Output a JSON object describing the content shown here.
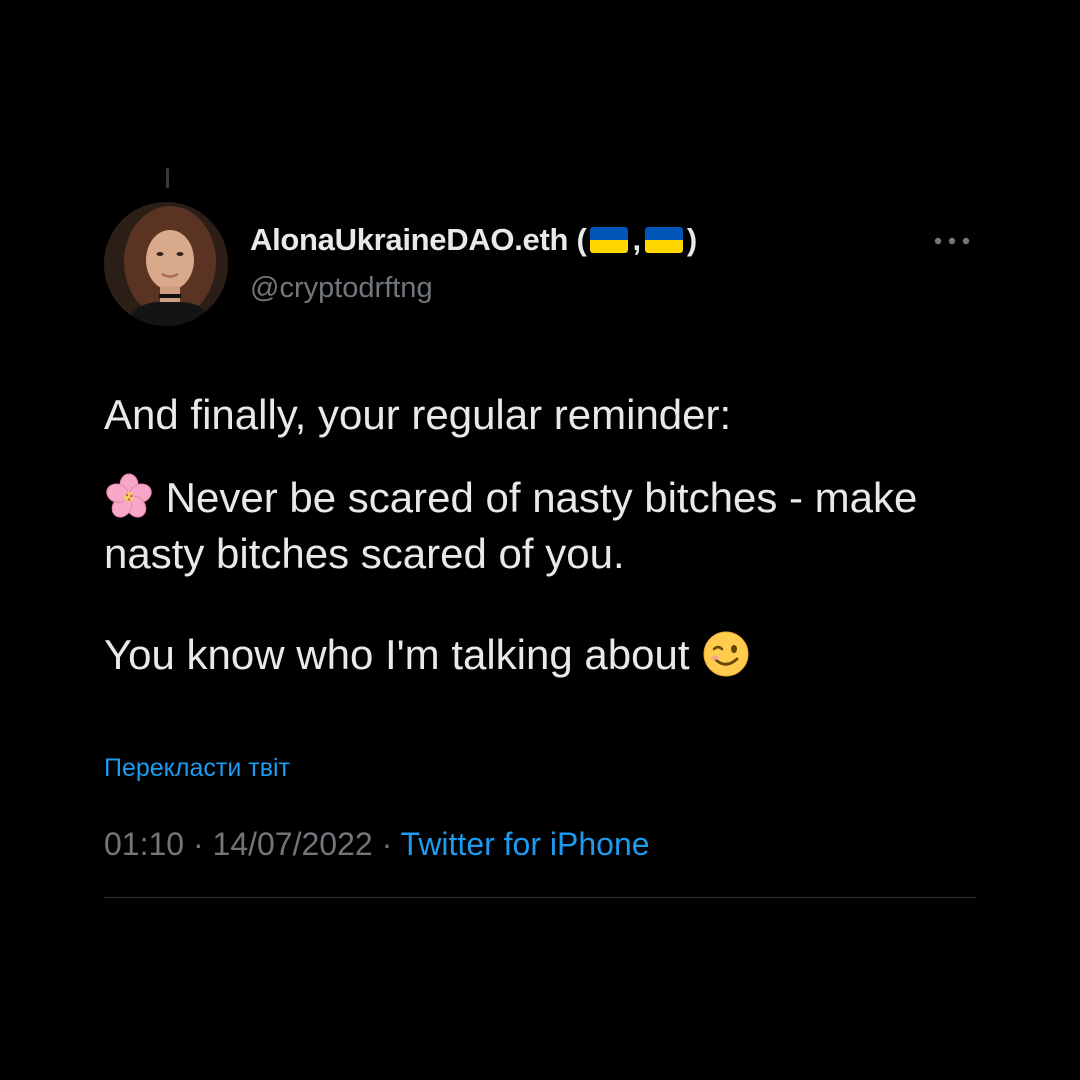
{
  "tweet": {
    "author": {
      "display_name": "AlonaUkraineDAO.eth (",
      "display_name_separator": ",",
      "display_name_end": ")",
      "handle": "@cryptodrftng"
    },
    "flags": [
      "ukraine-flag",
      "ukraine-flag"
    ],
    "text": {
      "line1": "And finally, your regular reminder:",
      "line2_emoji": "cherry-blossom-icon",
      "line2": "Never be scared of nasty bitches - make nasty bitches scared of you.",
      "line3": "You know who I'm talking about",
      "line3_emoji": "winking-face-icon"
    },
    "translate_label": "Перекласти твіт",
    "meta": {
      "time": "01:10",
      "separator": "·",
      "date": "14/07/2022",
      "source": "Twitter for iPhone"
    }
  },
  "colors": {
    "background": "#000000",
    "text_primary": "#e7e9ea",
    "text_secondary": "#71767b",
    "accent": "#1d9bf0",
    "divider": "#2f3336",
    "flag_blue": "#0057b7",
    "flag_yellow": "#ffd700"
  }
}
